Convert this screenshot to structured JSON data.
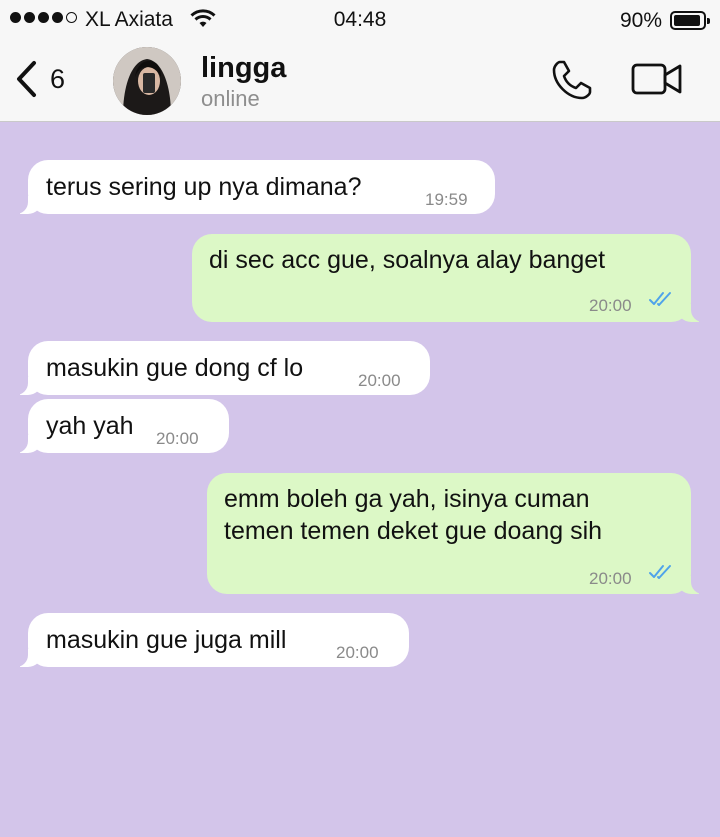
{
  "status_bar": {
    "carrier": "XL Axiata",
    "time": "04:48",
    "battery": "90%",
    "signal_strength": "4 of 5"
  },
  "header": {
    "back_count": "6",
    "contact_name": "lingga",
    "contact_status": "online"
  },
  "messages": [
    {
      "text": "terus sering up nya dimana?",
      "time": "19:59"
    },
    {
      "text": "di sec acc gue, soalnya alay banget",
      "time": "20:00"
    },
    {
      "text": "masukin gue dong cf lo",
      "time": "20:00"
    },
    {
      "text": "yah yah",
      "time": "20:00"
    },
    {
      "text_line1": "emm boleh ga yah, isinya cuman",
      "text_line2": "temen temen deket gue doang sih",
      "time": "20:00"
    },
    {
      "text": "masukin gue juga mill",
      "time": "20:00"
    }
  ],
  "colors": {
    "chat_background": "#d3c5ea",
    "incoming_bubble": "#ffffff",
    "outgoing_bubble": "#dcf8c6",
    "read_ticks": "#4fa3ea"
  },
  "icons": [
    "back-chevron-icon",
    "avatar",
    "phone-icon",
    "video-camera-icon",
    "double-check-icon",
    "wifi-icon",
    "battery-icon"
  ]
}
